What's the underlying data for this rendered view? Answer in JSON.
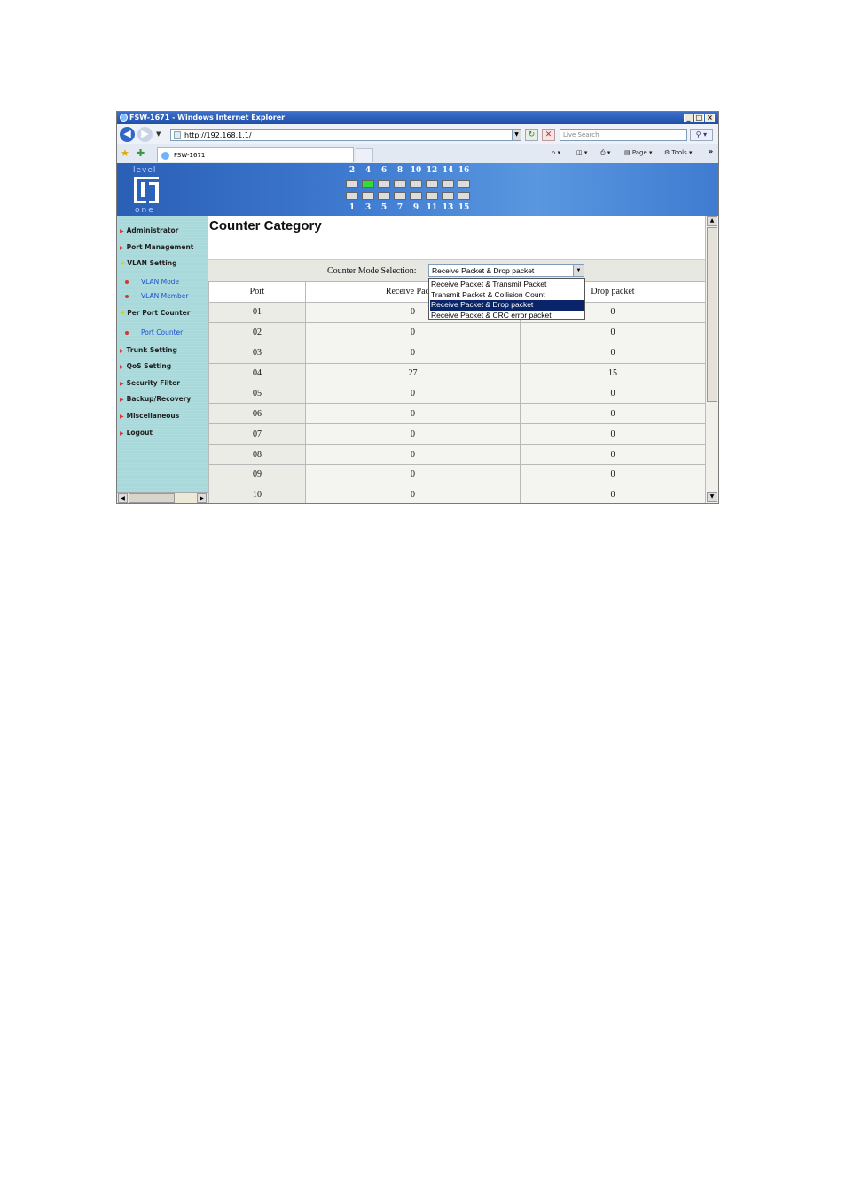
{
  "window": {
    "title": "FSW-1671 - Windows Internet Explorer"
  },
  "address_bar": {
    "url": "http://192.168.1.1/",
    "search_placeholder": "Live Search"
  },
  "tab": {
    "label": "FSW-1671"
  },
  "toolbar": {
    "page_label": "Page",
    "tools_label": "Tools"
  },
  "brand": {
    "top": "level",
    "bottom": "one"
  },
  "ports": {
    "top_numbers": [
      "2",
      "4",
      "6",
      "8",
      "10",
      "12",
      "14",
      "16"
    ],
    "bottom_numbers": [
      "1",
      "3",
      "5",
      "7",
      "9",
      "11",
      "13",
      "15"
    ],
    "active_top_index": 1,
    "active_color": "#33dd33"
  },
  "sidebar": {
    "items": [
      {
        "label": "Administrator",
        "type": "main"
      },
      {
        "label": "Port Management",
        "type": "main"
      },
      {
        "label": "VLAN Setting",
        "type": "main-open"
      },
      {
        "label": "VLAN Mode",
        "type": "sub"
      },
      {
        "label": "VLAN Member",
        "type": "sub"
      },
      {
        "label": "Per Port Counter",
        "type": "main-open"
      },
      {
        "label": "Port Counter",
        "type": "sub"
      },
      {
        "label": "Trunk Setting",
        "type": "main"
      },
      {
        "label": "QoS Setting",
        "type": "main"
      },
      {
        "label": "Security Filter",
        "type": "main"
      },
      {
        "label": "Backup/Recovery",
        "type": "main"
      },
      {
        "label": "Miscellaneous",
        "type": "main"
      },
      {
        "label": "Logout",
        "type": "main"
      }
    ]
  },
  "main": {
    "title": "Counter Category",
    "counter_mode_label": "Counter Mode Selection:",
    "selected_mode": "Receive Packet & Drop packet",
    "options": [
      "Receive Packet & Transmit Packet",
      "Transmit Packet & Collision Count",
      "Receive Packet & Drop packet",
      "Receive Packet & CRC error packet"
    ],
    "selected_option_index": 2,
    "columns": [
      "Port",
      "Receive Packet",
      "Drop packet"
    ],
    "rows": [
      [
        "01",
        "0",
        "0"
      ],
      [
        "02",
        "0",
        "0"
      ],
      [
        "03",
        "0",
        "0"
      ],
      [
        "04",
        "27",
        "15"
      ],
      [
        "05",
        "0",
        "0"
      ],
      [
        "06",
        "0",
        "0"
      ],
      [
        "07",
        "0",
        "0"
      ],
      [
        "08",
        "0",
        "0"
      ],
      [
        "09",
        "0",
        "0"
      ],
      [
        "10",
        "0",
        "0"
      ]
    ]
  }
}
